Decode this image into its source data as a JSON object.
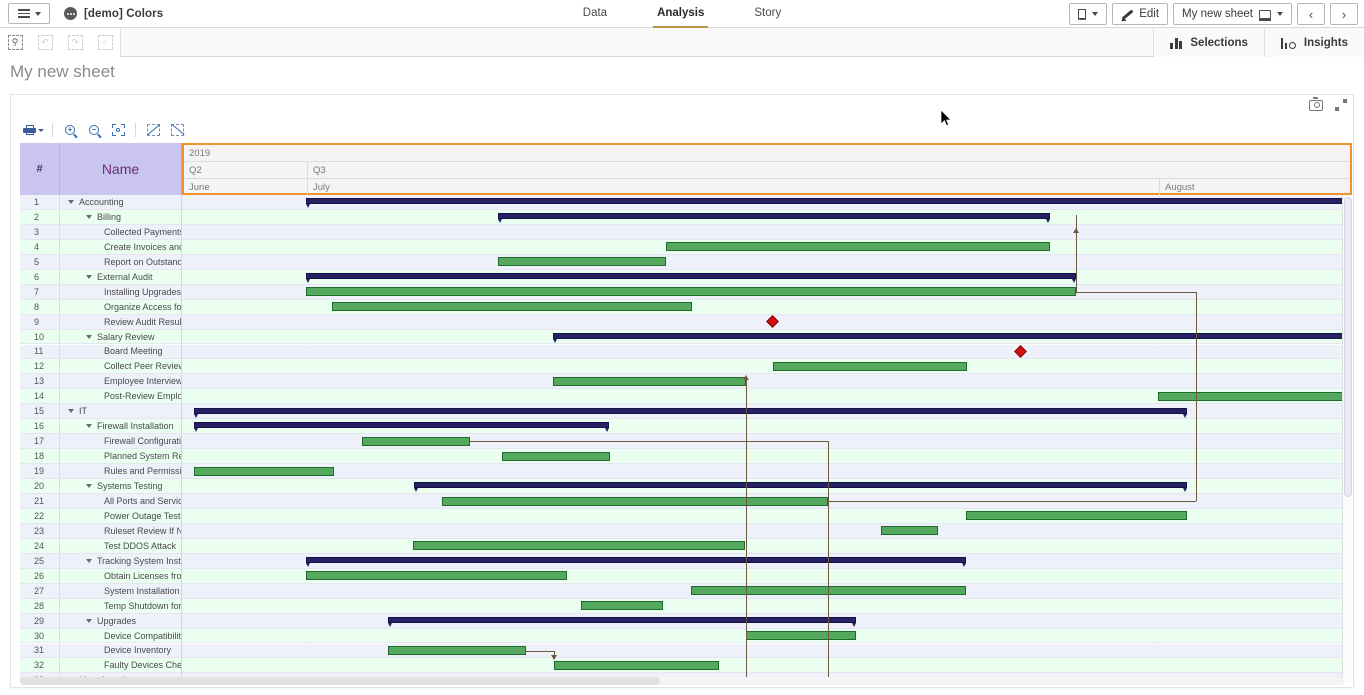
{
  "topbar": {
    "menu_icon": "hamburger-icon",
    "app_icon": "app-badge-icon",
    "app_title": "[demo] Colors",
    "tabs": [
      {
        "label": "Data",
        "active": false
      },
      {
        "label": "Analysis",
        "active": true
      },
      {
        "label": "Story",
        "active": false
      }
    ],
    "bookmark_label": "",
    "edit_label": "Edit",
    "sheet_label": "My new sheet",
    "prev_label": "‹",
    "next_label": "›"
  },
  "selectionbar": {
    "selections_label": "Selections",
    "insights_label": "Insights"
  },
  "sheet": {
    "title": "My new sheet"
  },
  "gantt_toolbar": {
    "print_label": "print-icon",
    "zoom_in_label": "+",
    "zoom_out_label": "−",
    "fit_label": "fit-icon",
    "collapse_label": "collapse-icon",
    "expand_label": "expand-icon"
  },
  "colors": {
    "accent_gold": "#b89444",
    "header_bg": "#c9c5ef",
    "header_text": "#6a2f7a",
    "row_alt": "#eaffef",
    "row_norm": "#eef0fa",
    "summary_bar": "#262163",
    "task_bar": "#55a95f",
    "task_bar_border": "#1f6b2e",
    "milestone": "#d40f0f",
    "dependency": "#6b5a3e",
    "selection_border": "#f0932b"
  },
  "chart_data": {
    "type": "gantt",
    "title": "",
    "columns": [
      "#",
      "Name"
    ],
    "timescale": {
      "years": [
        {
          "label": "2019",
          "start": 0,
          "end": 1170
        }
      ],
      "quarters": [
        {
          "label": "Q2",
          "start": 0,
          "end": 124
        },
        {
          "label": "Q3",
          "start": 124,
          "end": 1170
        }
      ],
      "months": [
        {
          "label": "June",
          "start": 0,
          "end": 124
        },
        {
          "label": "July",
          "start": 124,
          "end": 976
        },
        {
          "label": "August",
          "start": 976,
          "end": 1170
        }
      ]
    },
    "rows": [
      {
        "n": 1,
        "name": "Accounting",
        "indent": 0,
        "collapsible": true,
        "type": "summary",
        "start": 124,
        "end": 1172
      },
      {
        "n": 2,
        "name": "Billing",
        "indent": 1,
        "collapsible": true,
        "type": "summary",
        "start": 316,
        "end": 868
      },
      {
        "n": 3,
        "name": "Collected Payments Review",
        "indent": 2,
        "collapsible": false,
        "type": "none"
      },
      {
        "n": 4,
        "name": "Create Invoices and Send Invoices",
        "indent": 2,
        "collapsible": false,
        "type": "task",
        "start": 484,
        "end": 868
      },
      {
        "n": 5,
        "name": "Report on Outstanding Collections",
        "indent": 2,
        "collapsible": false,
        "type": "task",
        "start": 316,
        "end": 484
      },
      {
        "n": 6,
        "name": "External Audit",
        "indent": 1,
        "collapsible": true,
        "type": "summary",
        "start": 124,
        "end": 894
      },
      {
        "n": 7,
        "name": "Installing Upgrades",
        "indent": 2,
        "collapsible": false,
        "type": "task",
        "start": 124,
        "end": 894
      },
      {
        "n": 8,
        "name": "Organize Access for External Auditors",
        "indent": 2,
        "collapsible": false,
        "type": "task",
        "start": 150,
        "end": 510
      },
      {
        "n": 9,
        "name": "Review Audit Results",
        "indent": 2,
        "collapsible": false,
        "type": "milestone",
        "start": 590
      },
      {
        "n": 10,
        "name": "Salary Review",
        "indent": 1,
        "collapsible": true,
        "type": "summary",
        "start": 371,
        "end": 1172
      },
      {
        "n": 11,
        "name": "Board Meeting",
        "indent": 2,
        "collapsible": false,
        "type": "milestone",
        "start": 838
      },
      {
        "n": 12,
        "name": "Collect Peer Review Data",
        "indent": 2,
        "collapsible": false,
        "type": "task",
        "start": 591,
        "end": 785
      },
      {
        "n": 13,
        "name": "Employee Interviews",
        "indent": 2,
        "collapsible": false,
        "type": "task",
        "start": 371,
        "end": 564
      },
      {
        "n": 14,
        "name": "Post-Review Employee Interviews",
        "indent": 2,
        "collapsible": false,
        "type": "task",
        "start": 976,
        "end": 1172
      },
      {
        "n": 15,
        "name": "IT",
        "indent": 0,
        "collapsible": true,
        "type": "summary",
        "start": 12,
        "end": 1005
      },
      {
        "n": 16,
        "name": "Firewall Installation",
        "indent": 1,
        "collapsible": true,
        "type": "summary",
        "start": 12,
        "end": 427
      },
      {
        "n": 17,
        "name": "Firewall Configuration",
        "indent": 2,
        "collapsible": false,
        "type": "task",
        "start": 180,
        "end": 288
      },
      {
        "n": 18,
        "name": "Planned System Restart",
        "indent": 2,
        "collapsible": false,
        "type": "task",
        "start": 320,
        "end": 428
      },
      {
        "n": 19,
        "name": "Rules and Permissions Audit",
        "indent": 2,
        "collapsible": false,
        "type": "task",
        "start": 12,
        "end": 152
      },
      {
        "n": 20,
        "name": "Systems Testing",
        "indent": 1,
        "collapsible": true,
        "type": "summary",
        "start": 232,
        "end": 1005
      },
      {
        "n": 21,
        "name": "All Ports and Services Tested",
        "indent": 2,
        "collapsible": false,
        "type": "task",
        "start": 260,
        "end": 646
      },
      {
        "n": 22,
        "name": "Power Outage Tests",
        "indent": 2,
        "collapsible": false,
        "type": "task",
        "start": 784,
        "end": 1005
      },
      {
        "n": 23,
        "name": "Ruleset Review If Needed",
        "indent": 2,
        "collapsible": false,
        "type": "task",
        "start": 699,
        "end": 756
      },
      {
        "n": 24,
        "name": "Test DDOS Attack",
        "indent": 2,
        "collapsible": false,
        "type": "task",
        "start": 231,
        "end": 563
      },
      {
        "n": 25,
        "name": "Tracking System Installation",
        "indent": 1,
        "collapsible": true,
        "type": "summary",
        "start": 124,
        "end": 784
      },
      {
        "n": 26,
        "name": "Obtain Licenses from the Vendor",
        "indent": 2,
        "collapsible": false,
        "type": "task",
        "start": 124,
        "end": 385
      },
      {
        "n": 27,
        "name": "System Installation",
        "indent": 2,
        "collapsible": false,
        "type": "task",
        "start": 509,
        "end": 784
      },
      {
        "n": 28,
        "name": "Temp Shutdown for IT Audit",
        "indent": 2,
        "collapsible": false,
        "type": "task",
        "start": 399,
        "end": 481
      },
      {
        "n": 29,
        "name": "Upgrades",
        "indent": 1,
        "collapsible": true,
        "type": "summary",
        "start": 206,
        "end": 674
      },
      {
        "n": 30,
        "name": "Device Compatibility Review",
        "indent": 2,
        "collapsible": false,
        "type": "task",
        "start": 564,
        "end": 674
      },
      {
        "n": 31,
        "name": "Device Inventory",
        "indent": 2,
        "collapsible": false,
        "type": "task",
        "start": 206,
        "end": 344
      },
      {
        "n": 32,
        "name": "Faulty Devices Check",
        "indent": 2,
        "collapsible": false,
        "type": "task",
        "start": 372,
        "end": 537
      },
      {
        "n": 33,
        "name": "Manufacturing",
        "indent": 0,
        "collapsible": true,
        "type": "summary",
        "start": 124,
        "end": 950
      }
    ],
    "dependencies": [
      {
        "from_row": 7,
        "to_row": 9,
        "type": "finish-start"
      },
      {
        "from_row": 17,
        "to_row": 21,
        "type": "finish-start"
      },
      {
        "from_row": 31,
        "to_row": 32,
        "type": "finish-start"
      }
    ]
  }
}
